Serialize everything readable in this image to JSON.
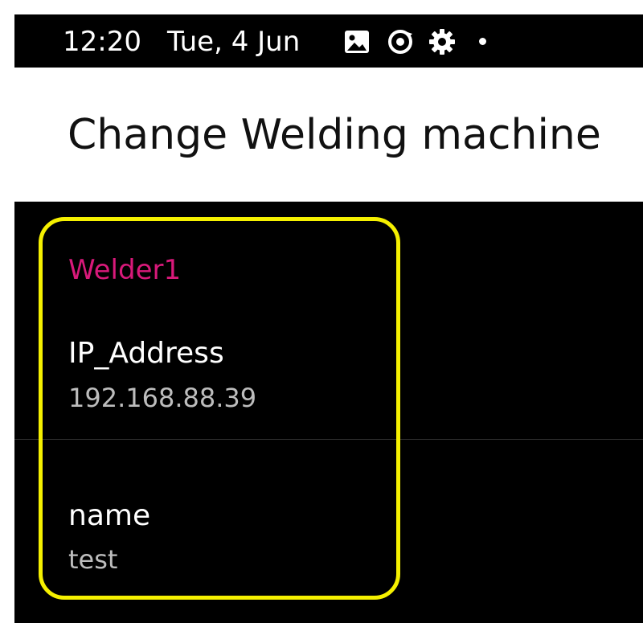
{
  "status_bar": {
    "time": "12:20",
    "date": "Tue, 4 Jun",
    "icons": [
      "gallery-icon",
      "sync-icon",
      "gear-icon",
      "notification-dot-icon"
    ]
  },
  "app_bar": {
    "title": "Change Welding machine"
  },
  "welder": {
    "name": "Welder1",
    "fields": [
      {
        "label": "IP_Address",
        "value": "192.168.88.39"
      },
      {
        "label": "name",
        "value": "test"
      }
    ]
  },
  "colors": {
    "accent": "#d8197a",
    "highlight": "#f5f000",
    "background": "#000000"
  }
}
